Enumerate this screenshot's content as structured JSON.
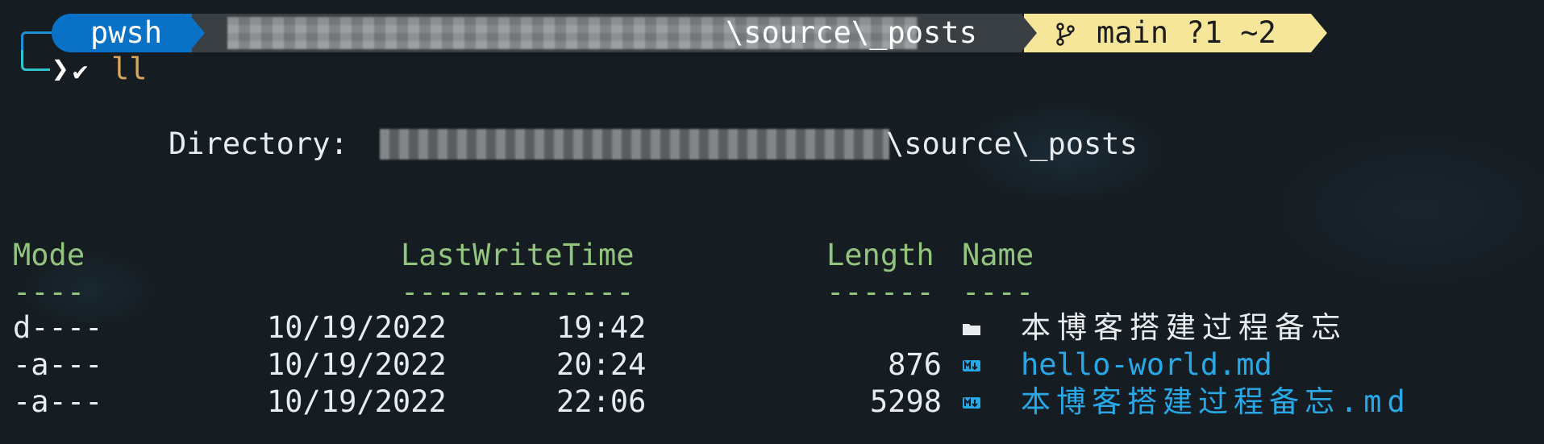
{
  "prompt": {
    "shell": "pwsh",
    "path_suffix": "\\source\\_posts",
    "git_branch": "main",
    "git_status": "?1 ~2",
    "command": "ll"
  },
  "directory": {
    "label": "Directory:",
    "path_suffix": "\\source\\_posts"
  },
  "table": {
    "headers": {
      "mode": "Mode",
      "last_write_time": "LastWriteTime",
      "length": "Length",
      "name": "Name"
    },
    "underlines": {
      "mode": "----",
      "last_write_time": "-------------",
      "length": "------",
      "name": "----"
    },
    "rows": [
      {
        "mode": "d----",
        "date": "10/19/2022",
        "time": "19:42",
        "length": "",
        "icon": "folder-icon",
        "name": "本博客搭建过程备忘"
      },
      {
        "mode": "-a---",
        "date": "10/19/2022",
        "time": "20:24",
        "length": "876",
        "icon": "markdown-file-icon",
        "name": "hello-world.md"
      },
      {
        "mode": "-a---",
        "date": "10/19/2022",
        "time": "22:06",
        "length": "5298",
        "icon": "markdown-file-icon",
        "name": "本博客搭建过程备忘.md"
      }
    ]
  },
  "colors": {
    "background": "#151d22",
    "shell_segment": "#0a72c6",
    "path_segment": "#3a3f44",
    "git_segment": "#f6e69a",
    "header_green": "#93c47d",
    "file_blue": "#29a8e8",
    "command_orange": "#d8a65c"
  }
}
